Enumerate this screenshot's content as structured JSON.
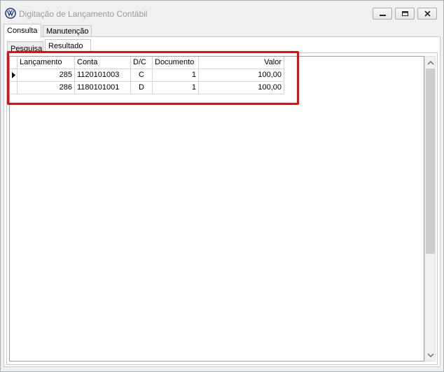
{
  "window": {
    "title": "Digitação de Lançamento Contábil",
    "title_color": "#9a9a9a",
    "app_icon": "vw-logo-icon"
  },
  "controls": {
    "minimize": "minimize-icon",
    "maximize": "maximize-icon",
    "close": "close-icon"
  },
  "outer_tabs": [
    {
      "label": "Consulta",
      "active": true
    },
    {
      "label": "Manutenção",
      "active": false
    }
  ],
  "inner_tabs": [
    {
      "label": "Pesquisa",
      "active": false
    },
    {
      "label": "Resultado",
      "active": true
    }
  ],
  "grid": {
    "columns": [
      "Lançamento",
      "Conta",
      "D/C",
      "Documento",
      "Valor"
    ],
    "rows": [
      {
        "lancamento": "285",
        "conta": "1120101003",
        "dc": "C",
        "documento": "1",
        "valor": "100,00",
        "current": true
      },
      {
        "lancamento": "286",
        "conta": "1180101001",
        "dc": "D",
        "documento": "1",
        "valor": "100,00",
        "current": false
      }
    ]
  },
  "highlight_color": "#e01010"
}
